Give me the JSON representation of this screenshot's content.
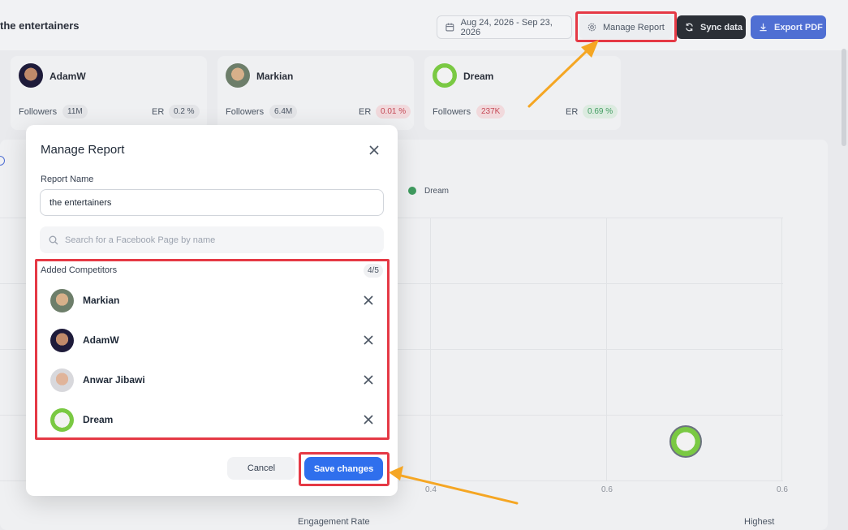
{
  "header": {
    "title": "the entertainers",
    "date_range": "Aug 24, 2026 - Sep 23, 2026",
    "manage_label": "Manage Report",
    "sync_label": "Sync data",
    "export_label": "Export PDF"
  },
  "cards": [
    {
      "name": "AdamW",
      "followers_label": "Followers",
      "followers": "11M",
      "er_label": "ER",
      "er": "0.2 %"
    },
    {
      "name": "Markian",
      "followers_label": "Followers",
      "followers": "6.4M",
      "er_label": "ER",
      "er": "0.01 %"
    },
    {
      "name": "Dream",
      "followers_label": "Followers",
      "followers": "237K",
      "er_label": "ER",
      "er": "0.69 %"
    }
  ],
  "chart": {
    "legend": "Dream",
    "x_ticks": [
      "0.4",
      "0.6",
      "0.6"
    ],
    "xlabel": "Engagement Rate",
    "highest": "Highest"
  },
  "modal": {
    "title": "Manage Report",
    "report_name_label": "Report Name",
    "report_name_value": "the entertainers",
    "search_placeholder": "Search for a Facebook Page by name",
    "added_label": "Added Competitors",
    "count": "4/5",
    "competitors": [
      {
        "name": "Markian"
      },
      {
        "name": "AdamW"
      },
      {
        "name": "Anwar Jibawi"
      },
      {
        "name": "Dream"
      }
    ],
    "cancel_label": "Cancel",
    "save_label": "Save changes"
  },
  "colors": {
    "accent": "#2f6fed",
    "highlight": "#e53945",
    "arrow": "#f5a623"
  }
}
